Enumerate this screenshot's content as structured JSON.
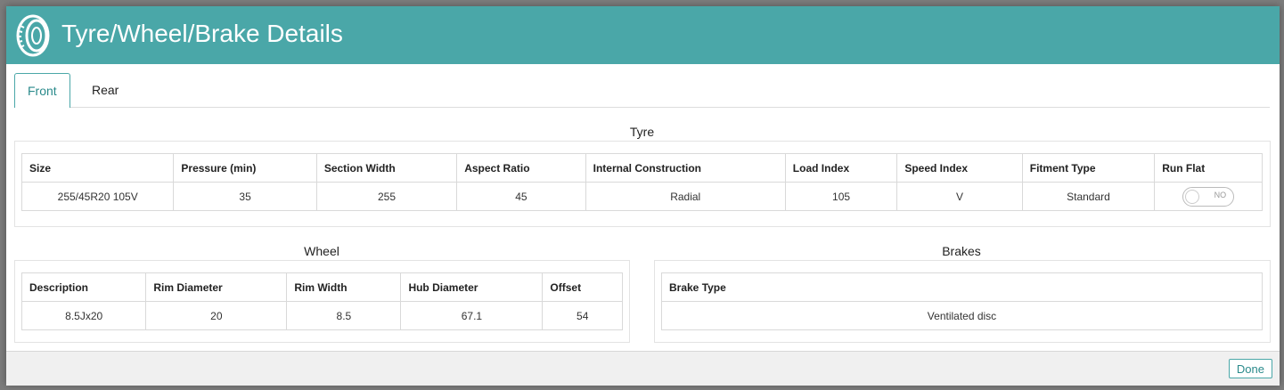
{
  "modal": {
    "title": "Tyre/Wheel/Brake Details",
    "icon": "tyre-icon",
    "accent_color": "#4aa7a8"
  },
  "tabs": [
    {
      "label": "Front",
      "active": true
    },
    {
      "label": "Rear",
      "active": false
    }
  ],
  "tyre": {
    "title": "Tyre",
    "columns": [
      "Size",
      "Pressure (min)",
      "Section Width",
      "Aspect Ratio",
      "Internal Construction",
      "Load Index",
      "Speed Index",
      "Fitment Type",
      "Run Flat"
    ],
    "row": [
      "255/45R20 105V",
      "35",
      "255",
      "45",
      "Radial",
      "105",
      "V",
      "Standard"
    ],
    "run_flat": {
      "label": "NO",
      "on": false
    }
  },
  "wheel": {
    "title": "Wheel",
    "columns": [
      "Description",
      "Rim Diameter",
      "Rim Width",
      "Hub Diameter",
      "Offset"
    ],
    "row": [
      "8.5Jx20",
      "20",
      "8.5",
      "67.1",
      "54"
    ]
  },
  "brakes": {
    "title": "Brakes",
    "columns": [
      "Brake Type"
    ],
    "row": [
      "Ventilated disc"
    ]
  },
  "footer": {
    "done_label": "Done"
  }
}
